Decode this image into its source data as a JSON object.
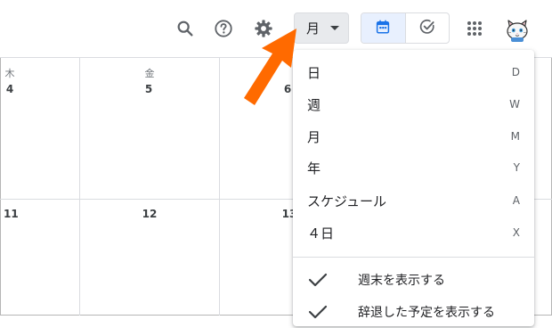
{
  "header": {
    "view_selector": {
      "label": "月"
    }
  },
  "grid": {
    "columns": [
      {
        "dow": "木",
        "day": "4"
      },
      {
        "dow": "金",
        "day": "5"
      },
      {
        "dow": "",
        "day": "6"
      }
    ],
    "second_row": [
      "11",
      "12",
      "13"
    ]
  },
  "menu": {
    "items": [
      {
        "label": "日",
        "shortcut": "D"
      },
      {
        "label": "週",
        "shortcut": "W"
      },
      {
        "label": "月",
        "shortcut": "M"
      },
      {
        "label": "年",
        "shortcut": "Y"
      },
      {
        "label": "スケジュール",
        "shortcut": "A"
      },
      {
        "label": "４日",
        "shortcut": "X"
      }
    ],
    "options": [
      {
        "label": "週末を表示する",
        "checked": true
      },
      {
        "label": "辞退した予定を表示する",
        "checked": true
      }
    ]
  },
  "colors": {
    "accent_blue": "#1a73e8",
    "arrow_orange": "#ff6a00"
  },
  "icons": [
    "search-icon",
    "help-icon",
    "settings-icon",
    "caret-down-icon",
    "calendar-icon",
    "tasks-icon",
    "apps-icon",
    "avatar-cat",
    "checkmark-icon"
  ]
}
